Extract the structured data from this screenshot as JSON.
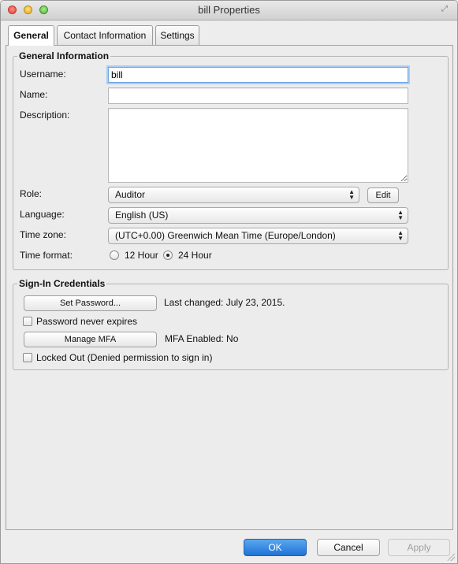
{
  "window": {
    "title": "bill Properties"
  },
  "tabs": [
    {
      "label": "General"
    },
    {
      "label": "Contact Information"
    },
    {
      "label": "Settings"
    }
  ],
  "general_info": {
    "legend": "General Information",
    "username_label": "Username:",
    "username_value": "bill",
    "name_label": "Name:",
    "name_value": "",
    "description_label": "Description:",
    "description_value": "",
    "role_label": "Role:",
    "role_value": "Auditor",
    "edit_label": "Edit",
    "language_label": "Language:",
    "language_value": "English (US)",
    "timezone_label": "Time zone:",
    "timezone_value": "(UTC+0.00) Greenwich Mean Time (Europe/London)",
    "timeformat_label": "Time format:",
    "time_12_label": "12 Hour",
    "time_24_label": "24 Hour",
    "time_format_selected": "24 Hour"
  },
  "credentials": {
    "legend": "Sign-In Credentials",
    "set_password_label": "Set Password...",
    "last_changed_text": "Last changed: July 23, 2015.",
    "never_expires_label": "Password never expires",
    "never_expires_checked": false,
    "manage_mfa_label": "Manage MFA",
    "mfa_text": "MFA Enabled: No",
    "locked_out_label": "Locked Out (Denied permission to sign in)",
    "locked_out_checked": false
  },
  "footer": {
    "ok_label": "OK",
    "cancel_label": "Cancel",
    "apply_label": "Apply"
  },
  "colors": {
    "accent": "#1f73d6",
    "focus_ring": "#a9cdf5"
  }
}
